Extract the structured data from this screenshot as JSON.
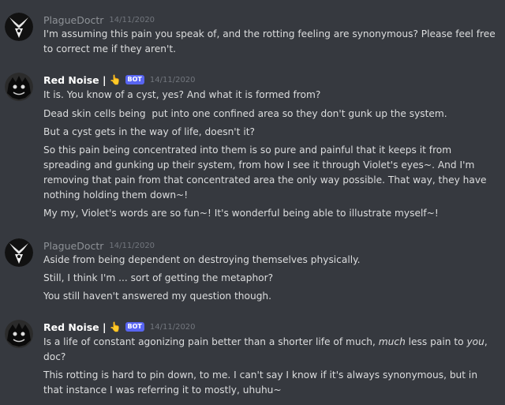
{
  "messages": [
    {
      "author": "PlagueDoctr",
      "time": "14/11/2020",
      "lines": [
        "I'm assuming this pain you speak of, and the rotting feeling are synonymous? Please feel free",
        "to correct me if they aren't."
      ]
    },
    {
      "author": "Red Noise |",
      "badge": "BOT",
      "time": "14/11/2020",
      "lines": [
        "It is. You know of a cyst, yes? And what it is formed from?",
        "Dead skin cells being  put into one confined area so they don't gunk up the system.",
        "But a cyst gets in the way of life, doesn't it?",
        "So this pain being concentrated into them is so pure and painful that it keeps it from",
        "spreading and gunking up their system, from how I see it through Violet's eyes~. And I'm",
        "removing that pain from that concentrated area the only way possible. That way, they have",
        "nothing holding them down~!",
        "My my, Violet's words are so fun~! It's wonderful being able to illustrate myself~!"
      ]
    },
    {
      "author": "PlagueDoctr",
      "time": "14/11/2020",
      "lines": [
        "Aside from being dependent on destroying themselves physically.",
        "Still, I think I'm ... sort of getting the metaphor?",
        "You still haven't answered my question though."
      ]
    },
    {
      "author": "Red Noise |",
      "badge": "BOT",
      "time": "14/11/2020",
      "lines_rich": {
        "l1_a": "Is a life of constant agonizing pain better than a shorter life of much, ",
        "l1_b": "much",
        "l1_c": " less pain to ",
        "l1_d": "you",
        "l1_e": ","
      },
      "lines": [
        "doc?",
        "This rotting is hard to pin down, to me. I can't say I know if it's always synonymous, but in",
        "that instance I was referring it to mostly, uhuhu~"
      ]
    }
  ]
}
